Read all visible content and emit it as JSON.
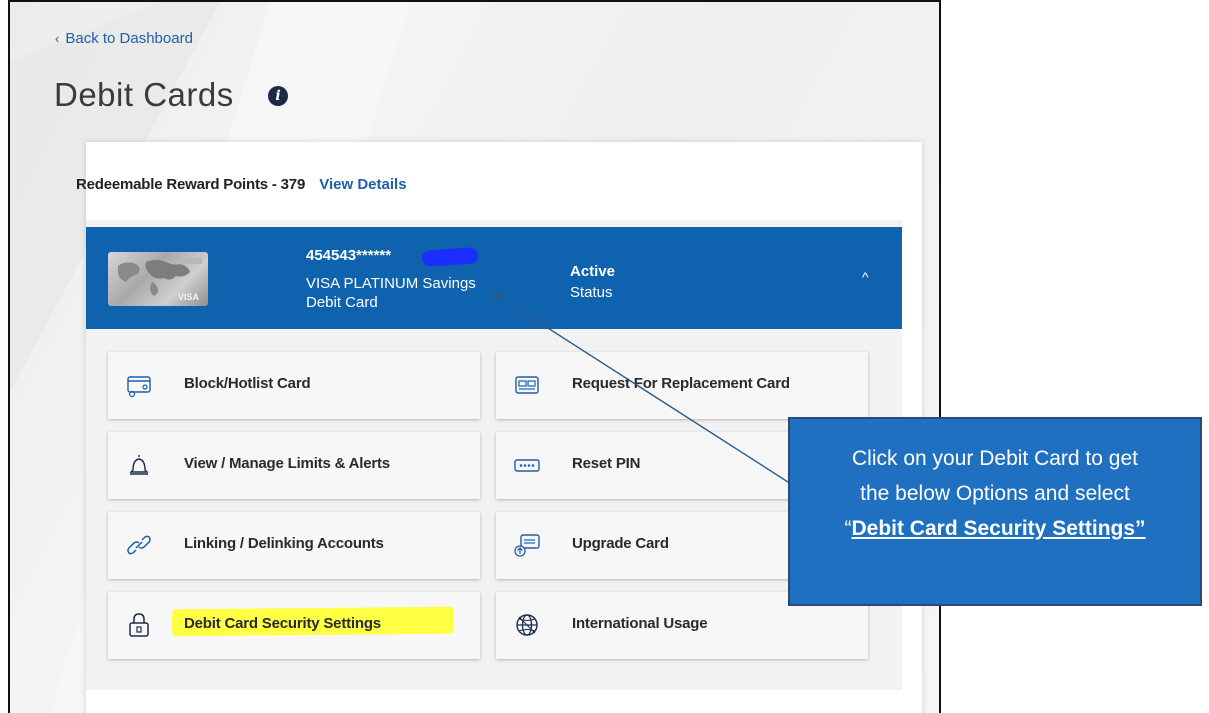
{
  "nav": {
    "back_link": "Back to Dashboard",
    "back_chevron": "‹"
  },
  "page": {
    "title": "Debit Cards",
    "info_icon": "info-icon"
  },
  "rewards": {
    "text": "Redeemable Reward Points - 379",
    "link": "View Details"
  },
  "card": {
    "number": "454543******",
    "name_line1": "VISA PLATINUM Savings",
    "name_line2": "Debit Card",
    "status_value": "Active",
    "status_label": "Status",
    "thumb_brand": "VISA",
    "header_color": "#0f62ae"
  },
  "options": [
    {
      "label": "Block/Hotlist Card",
      "icon": "card-block-icon"
    },
    {
      "label": "Request For Replacement Card",
      "icon": "card-replace-icon"
    },
    {
      "label": "View / Manage Limits & Alerts",
      "icon": "bell-icon"
    },
    {
      "label": "Reset PIN",
      "icon": "pin-icon"
    },
    {
      "label": "Linking / Delinking Accounts",
      "icon": "link-icon"
    },
    {
      "label": "Upgrade Card",
      "icon": "upgrade-card-icon"
    },
    {
      "label": "Debit Card Security Settings",
      "icon": "lock-icon"
    },
    {
      "label": "International Usage",
      "icon": "globe-icon"
    }
  ],
  "callout": {
    "line1": "Click on your Debit Card to get",
    "line2": "the below Options and select",
    "open_quote": "“",
    "emphasis": "Debit Card Security Settings”",
    "fill": "#1f70c1"
  },
  "highlight_color": "#ffff44"
}
